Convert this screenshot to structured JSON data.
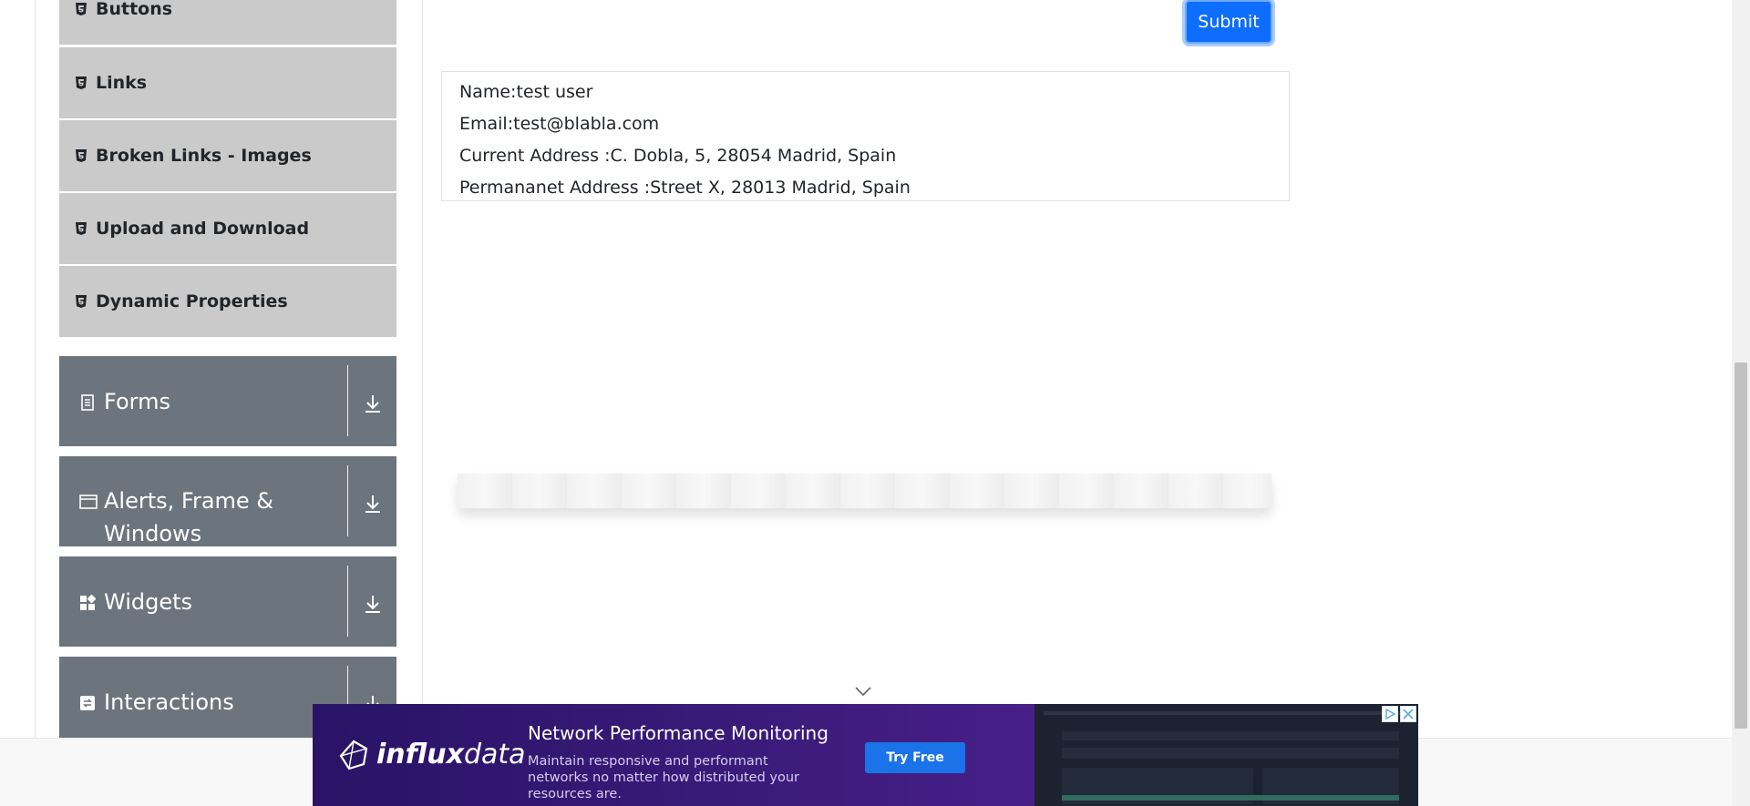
{
  "sidebar": {
    "sub_items": [
      {
        "label": "Buttons",
        "icon": "html5-icon"
      },
      {
        "label": "Links",
        "icon": "html5-icon"
      },
      {
        "label": "Broken Links - Images",
        "icon": "html5-icon"
      },
      {
        "label": "Upload and Download",
        "icon": "html5-icon"
      },
      {
        "label": "Dynamic Properties",
        "icon": "html5-icon"
      }
    ],
    "groups": [
      {
        "label": "Forms",
        "icon": "document-icon"
      },
      {
        "label": "Alerts, Frame &",
        "label_line2": "Windows",
        "icon": "window-icon"
      },
      {
        "label": "Widgets",
        "icon": "widgets-icon"
      },
      {
        "label": "Interactions",
        "icon": "interactions-icon"
      }
    ]
  },
  "form": {
    "submit_label": "Submit"
  },
  "output": {
    "name": "Name:test user",
    "email": "Email:test@blabla.com",
    "current_address": "Current Address :C. Dobla, 5, 28054 Madrid, Spain",
    "permanent_address": "Permananet Address :Street X, 28013 Madrid, Spain"
  },
  "ad": {
    "brand_bold": "influx",
    "brand_rest": "data",
    "title": "Network Performance Monitoring",
    "description": "Maintain responsive and performant networks no matter how distributed your resources are.",
    "cta": "Try Free"
  },
  "colors": {
    "sidebar_subitem_bg": "#cacaca",
    "sidebar_group_bg": "#6c757d",
    "primary": "#0d6efd",
    "ad_bg": "#3a1b7a"
  }
}
